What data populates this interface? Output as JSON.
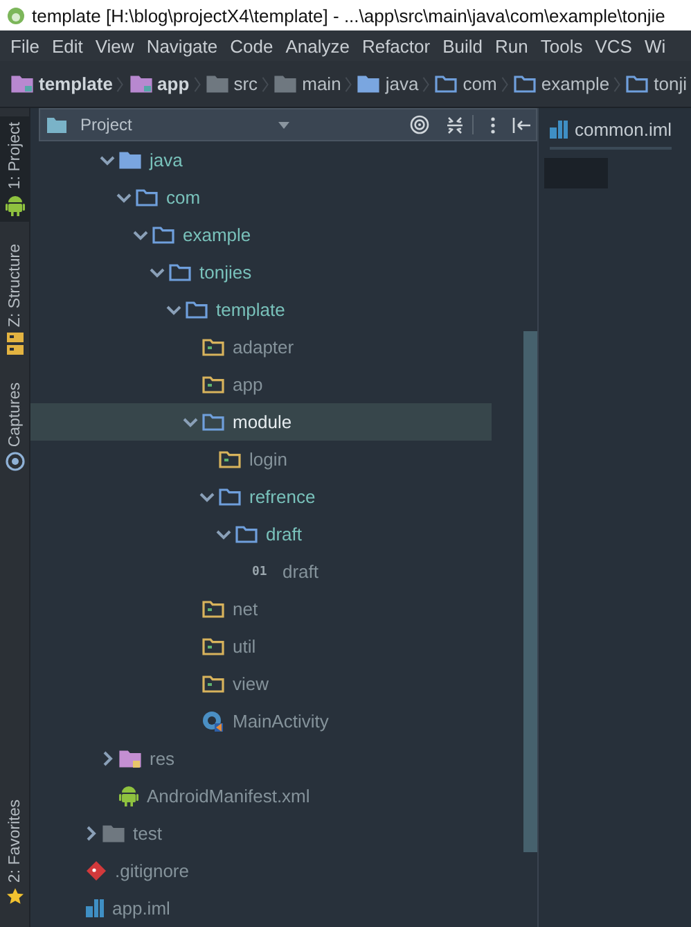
{
  "window": {
    "title": "template [H:\\blog\\projectX4\\template] - ...\\app\\src\\main\\java\\com\\example\\tonjie"
  },
  "menu": [
    "File",
    "Edit",
    "View",
    "Navigate",
    "Code",
    "Analyze",
    "Refactor",
    "Build",
    "Run",
    "Tools",
    "VCS",
    "Wi"
  ],
  "breadcrumb": [
    {
      "label": "template",
      "kind": "module"
    },
    {
      "label": "app",
      "kind": "module"
    },
    {
      "label": "src",
      "kind": "folder"
    },
    {
      "label": "main",
      "kind": "folder"
    },
    {
      "label": "java",
      "kind": "source"
    },
    {
      "label": "com",
      "kind": "package"
    },
    {
      "label": "example",
      "kind": "package"
    },
    {
      "label": "tonji",
      "kind": "package"
    }
  ],
  "tool_strip": [
    {
      "label": "1: Project",
      "kind": "android",
      "selected": true
    },
    {
      "label": "Z: Structure",
      "kind": "structure",
      "selected": false
    },
    {
      "label": "Captures",
      "kind": "captures",
      "selected": false
    }
  ],
  "bottom_tools": [
    {
      "label": "2: Favorites",
      "kind": "star",
      "selected": false
    }
  ],
  "project_panel": {
    "title": "Project",
    "tree": [
      {
        "children": [
          {
            "children": [
              {
                "label": "java",
                "kind": "source",
                "expanded": true,
                "selected": false,
                "children": [
                  {
                    "label": "com",
                    "kind": "package",
                    "expanded": true,
                    "selected": false,
                    "children": [
                      {
                        "label": "example",
                        "kind": "package",
                        "expanded": true,
                        "selected": false,
                        "children": [
                          {
                            "label": "tonjies",
                            "kind": "package",
                            "expanded": true,
                            "selected": false,
                            "children": [
                              {
                                "label": "template",
                                "kind": "package",
                                "expanded": true,
                                "selected": false,
                                "children": [
                                  {
                                    "label": "adapter",
                                    "kind": "package-leaf",
                                    "selected": false
                                  },
                                  {
                                    "label": "app",
                                    "kind": "package-leaf",
                                    "selected": false
                                  },
                                  {
                                    "label": "module",
                                    "kind": "package",
                                    "expanded": true,
                                    "selected": true,
                                    "children": [
                                      {
                                        "label": "login",
                                        "kind": "package-leaf",
                                        "selected": false
                                      },
                                      {
                                        "label": "refrence",
                                        "kind": "package",
                                        "expanded": true,
                                        "selected": false,
                                        "children": [
                                          {
                                            "label": "draft",
                                            "kind": "package",
                                            "expanded": true,
                                            "selected": false,
                                            "children": [
                                              {
                                                "label": "draft",
                                                "kind": "text-file",
                                                "badge": "01",
                                                "selected": false
                                              }
                                            ]
                                          }
                                        ]
                                      }
                                    ]
                                  },
                                  {
                                    "label": "net",
                                    "kind": "package-leaf",
                                    "selected": false
                                  },
                                  {
                                    "label": "util",
                                    "kind": "package-leaf",
                                    "selected": false
                                  },
                                  {
                                    "label": "view",
                                    "kind": "package-leaf",
                                    "selected": false
                                  },
                                  {
                                    "label": "MainActivity",
                                    "kind": "class-file",
                                    "selected": false
                                  }
                                ]
                              }
                            ]
                          }
                        ]
                      }
                    ]
                  }
                ]
              },
              {
                "label": "res",
                "kind": "res-folder",
                "expanded": false,
                "selected": false
              },
              {
                "label": "AndroidManifest.xml",
                "kind": "android-file",
                "selected": false
              }
            ]
          },
          {
            "label": "test",
            "kind": "folder",
            "expanded": false,
            "selected": false
          }
        ]
      },
      {
        "label": ".gitignore",
        "kind": "git-file",
        "selected": false
      },
      {
        "label": "app.iml",
        "kind": "iml-file",
        "selected": false
      }
    ]
  },
  "editor": {
    "tabs": [
      {
        "label": "common.iml",
        "kind": "iml-file",
        "selected": true
      }
    ]
  }
}
